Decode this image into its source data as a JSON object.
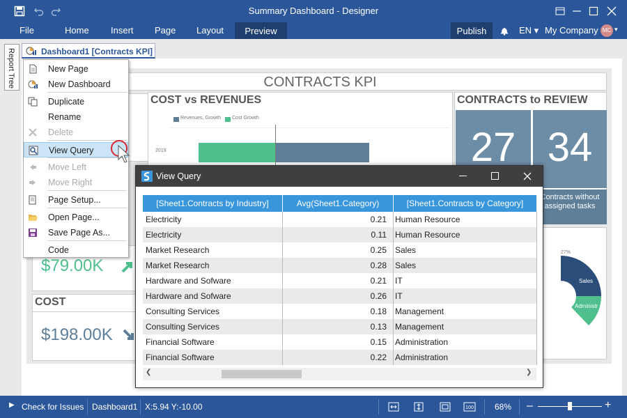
{
  "app": {
    "title": "Summary Dashboard - Designer"
  },
  "ribbon": {
    "tabs": [
      "File",
      "Home",
      "Insert",
      "Page",
      "Layout",
      "Preview"
    ],
    "publish": "Publish",
    "language": "EN",
    "account": "My Company",
    "avatar_initials": "MC"
  },
  "side_panel": {
    "report_tree": "Report Tree"
  },
  "doc_tab": {
    "label": "Dashboard1 [Contracts KPI]"
  },
  "dashboard": {
    "title": "CONTRACTS  KPI",
    "cost_rev": {
      "title": "COST vs REVENUES",
      "legend": [
        "Revenues, Growth",
        "Cost Growth"
      ],
      "y_tick": "2019"
    },
    "review": {
      "title": "CONTRACTS to REVIEW",
      "values": [
        "27",
        "34"
      ],
      "caption": "Contracts without assigned tasks"
    },
    "kpi1": {
      "value": "$79.00K"
    },
    "cost": {
      "title": "COST",
      "value": "$198.00K"
    },
    "donut": {
      "pct": "27%",
      "labels": [
        "Sales",
        "Administr",
        "e"
      ]
    }
  },
  "context_menu": {
    "items": [
      {
        "label": "New Page",
        "icon": "new-page-icon",
        "disabled": false
      },
      {
        "label": "New Dashboard",
        "icon": "new-dashboard-icon",
        "disabled": false
      },
      {
        "label": "Duplicate",
        "icon": "duplicate-icon",
        "disabled": false
      },
      {
        "label": "Rename",
        "icon": "",
        "disabled": false
      },
      {
        "label": "Delete",
        "icon": "delete-icon",
        "disabled": true
      },
      {
        "label": "View Query",
        "icon": "view-query-icon",
        "disabled": false
      },
      {
        "label": "Move Left",
        "icon": "move-left-icon",
        "disabled": true
      },
      {
        "label": "Move Right",
        "icon": "move-right-icon",
        "disabled": true
      },
      {
        "label": "Page Setup...",
        "icon": "page-setup-icon",
        "disabled": false
      },
      {
        "label": "Open Page...",
        "icon": "folder-icon",
        "disabled": false
      },
      {
        "label": "Save Page As...",
        "icon": "save-icon",
        "disabled": false
      },
      {
        "label": "Code",
        "icon": "",
        "disabled": false
      }
    ]
  },
  "dialog": {
    "title": "View Query",
    "columns": [
      "[Sheet1.Contracts by Industry]",
      "Avg(Sheet1.Category)",
      "[Sheet1.Contracts by Category]"
    ],
    "rows": [
      [
        "Electricity",
        "0.21",
        "Human Resource"
      ],
      [
        "Electricity",
        "0.11",
        "Human Resource"
      ],
      [
        "Market Research",
        "0.25",
        "Sales"
      ],
      [
        "Market Research",
        "0.28",
        "Sales"
      ],
      [
        "Hardware and Sofware",
        "0.21",
        "IT"
      ],
      [
        "Hardware and Sofware",
        "0.26",
        "IT"
      ],
      [
        "Consulting Services",
        "0.18",
        "Management"
      ],
      [
        "Consulting Services",
        "0.13",
        "Management"
      ],
      [
        "Financial Software",
        "0.15",
        "Administration"
      ],
      [
        "Financial Software",
        "0.22",
        "Administration"
      ]
    ]
  },
  "status": {
    "check": "Check for Issues",
    "page": "Dashboard1",
    "coords": "X:5.94 Y:-10.00",
    "zoom": "68%",
    "zoom_level": 0.68
  },
  "colors": {
    "brand": "#2b579a",
    "header": "#3a96db",
    "kpi_box": "#6d8ca6",
    "green": "#4fc08d",
    "steel": "#5e7f99",
    "navy": "#2a4d7a"
  }
}
